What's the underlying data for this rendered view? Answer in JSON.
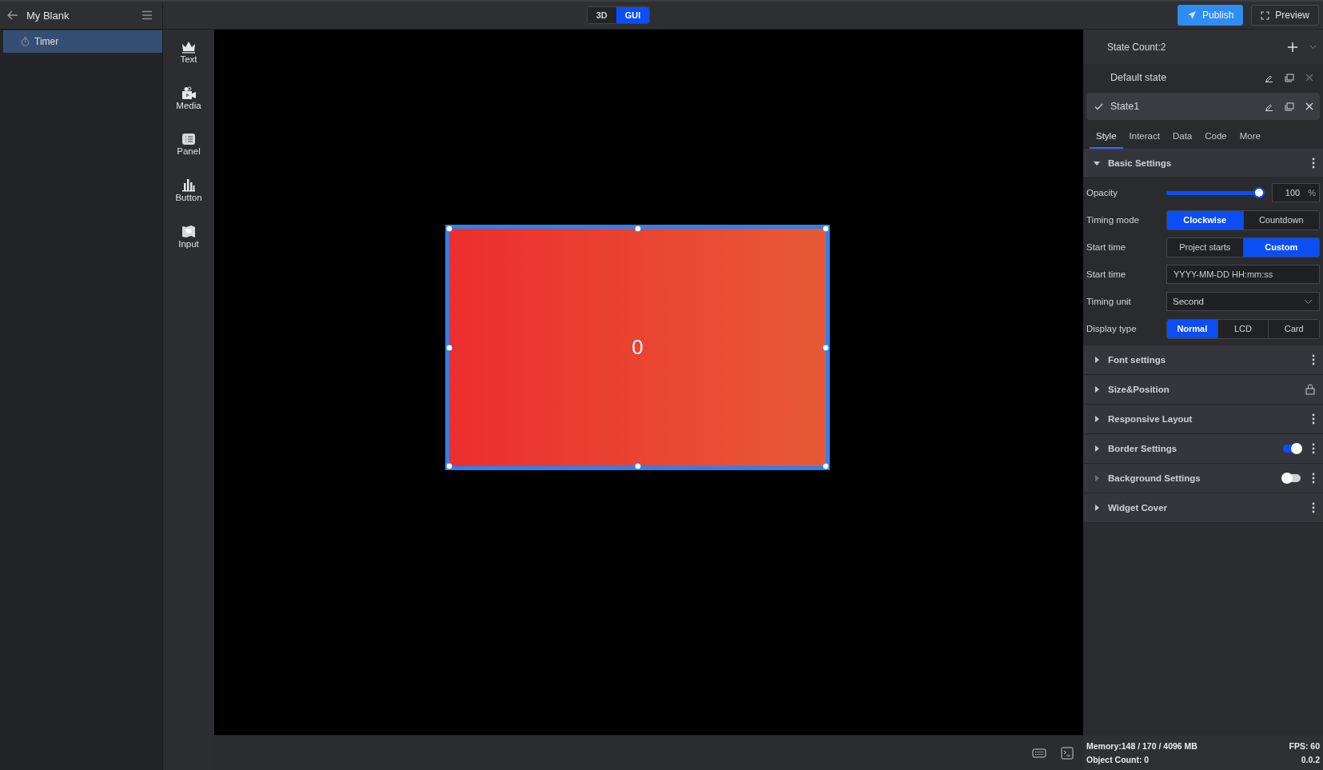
{
  "header": {
    "title": "My Blank"
  },
  "view_toggle": [
    {
      "label": "3D",
      "selected": false
    },
    {
      "label": "GUI",
      "selected": true
    }
  ],
  "actions": [
    {
      "label": "Publish",
      "kind": "primary"
    },
    {
      "label": "Preview",
      "kind": "outline"
    }
  ],
  "layers": [
    {
      "label": "Timer",
      "selected": true
    }
  ],
  "tools": [
    {
      "label": "Text",
      "kind": "text"
    },
    {
      "label": "Media",
      "kind": "media"
    },
    {
      "label": "Panel",
      "kind": "panel"
    },
    {
      "label": "Button",
      "kind": "chart"
    },
    {
      "label": "Input",
      "kind": "map"
    }
  ],
  "widget": {
    "value": "0",
    "selected": true
  },
  "states": {
    "count_label": "State Count:2",
    "items": [
      {
        "name": "Default state",
        "selected": false
      },
      {
        "name": "State1",
        "selected": true
      }
    ]
  },
  "tabs": [
    {
      "label": "Style",
      "selected": true
    },
    {
      "label": "Interact",
      "selected": false
    },
    {
      "label": "Data",
      "selected": false
    },
    {
      "label": "Code",
      "selected": false
    },
    {
      "label": "More",
      "selected": false
    }
  ],
  "basic_settings": {
    "title": "Basic Settings",
    "expanded": true,
    "rows": [
      {
        "kind": "slider",
        "label": "Opacity",
        "level": 1,
        "value": "100",
        "unit": "%"
      },
      {
        "kind": "segmented",
        "label": "Timing mode",
        "options": [
          {
            "label": "Clockwise",
            "selected": true
          },
          {
            "label": "Countdown",
            "selected": false
          }
        ]
      },
      {
        "kind": "segmented",
        "label": "Start time",
        "options": [
          {
            "label": "Project starts",
            "selected": false
          },
          {
            "label": "Custom",
            "selected": true
          }
        ]
      },
      {
        "kind": "input",
        "label": "Start time",
        "placeholder": "YYYY-MM-DD HH:mm:ss"
      },
      {
        "kind": "select",
        "label": "Timing unit",
        "value": "Second"
      },
      {
        "kind": "segmented",
        "label": "Display type",
        "options": [
          {
            "label": "Normal",
            "selected": true
          },
          {
            "label": "LCD",
            "selected": false
          },
          {
            "label": "Card",
            "selected": false
          }
        ]
      }
    ]
  },
  "sections": [
    {
      "title": "Font settings",
      "kind": "menu",
      "expanded": false
    },
    {
      "title": "Size&Position",
      "kind": "lock",
      "expanded": false
    },
    {
      "title": "Responsive Layout",
      "kind": "menu",
      "expanded": false
    },
    {
      "title": "Border Settings",
      "kind": "toggle",
      "on": true,
      "expanded": false
    },
    {
      "title": "Background Settings",
      "kind": "toggle",
      "on": false,
      "expanded": false
    },
    {
      "title": "Widget Cover",
      "kind": "menu",
      "expanded": false
    }
  ],
  "status": {
    "memory": "Memory:148 / 170 / 4096 MB",
    "fps": "FPS: 60",
    "objects": "Object Count: 0",
    "version": "0.0.2"
  }
}
